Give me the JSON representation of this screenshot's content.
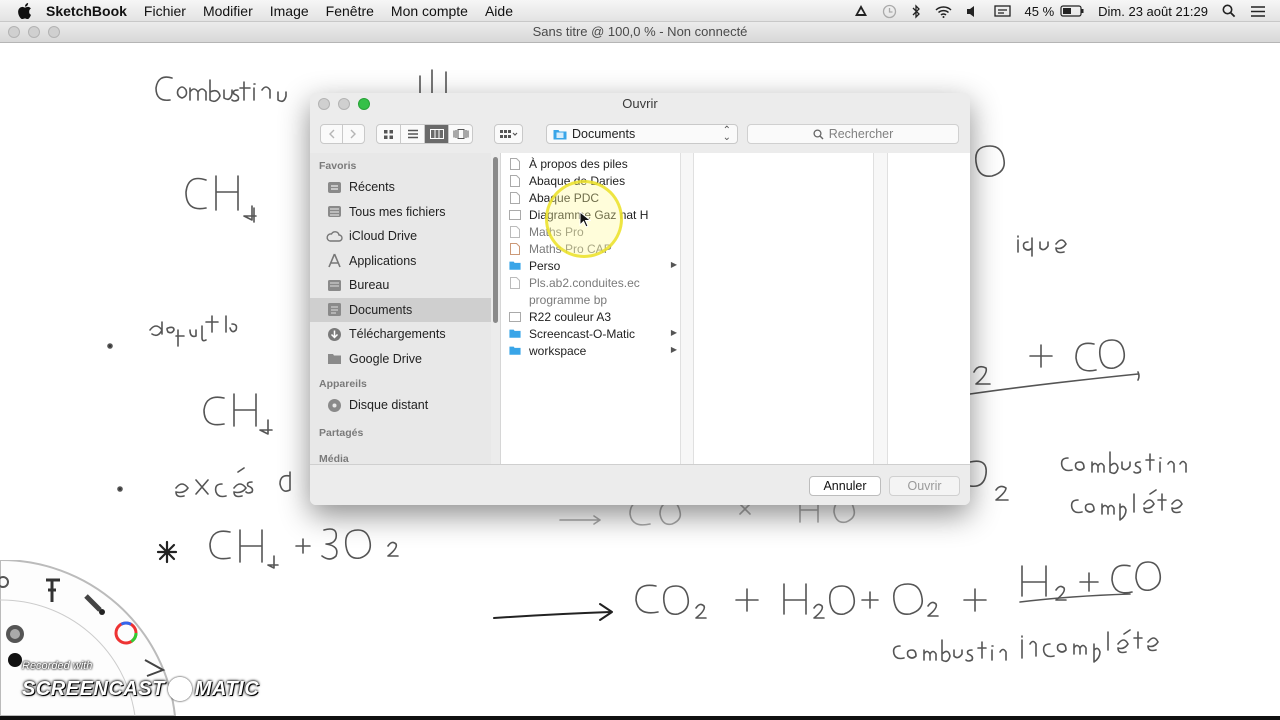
{
  "menubar": {
    "app_name": "SketchBook",
    "items": [
      "Fichier",
      "Modifier",
      "Image",
      "Fenêtre",
      "Mon compte",
      "Aide"
    ],
    "battery": "45 %",
    "datetime": "Dim. 23 août  21:29"
  },
  "window": {
    "title": "Sans titre @ 100,0 % - Non connecté"
  },
  "dialog": {
    "title": "Ouvrir",
    "location": "Documents",
    "search_placeholder": "Rechercher",
    "sidebar": {
      "sections": [
        {
          "heading": "Favoris",
          "items": [
            {
              "label": "Récents",
              "icon": "recents-icon"
            },
            {
              "label": "Tous mes fichiers",
              "icon": "all-files-icon"
            },
            {
              "label": "iCloud Drive",
              "icon": "cloud-icon"
            },
            {
              "label": "Applications",
              "icon": "applications-icon"
            },
            {
              "label": "Bureau",
              "icon": "desktop-icon"
            },
            {
              "label": "Documents",
              "icon": "documents-icon",
              "selected": true
            },
            {
              "label": "Téléchargements",
              "icon": "downloads-icon"
            },
            {
              "label": "Google Drive",
              "icon": "folder-icon"
            }
          ]
        },
        {
          "heading": "Appareils",
          "items": [
            {
              "label": "Disque distant",
              "icon": "disc-icon"
            }
          ]
        },
        {
          "heading": "Partagés",
          "items": []
        },
        {
          "heading": "Média",
          "items": []
        }
      ]
    },
    "files": [
      {
        "name": "À propos des piles",
        "type": "doc",
        "dim": false
      },
      {
        "name": "Abaque de Daries",
        "type": "doc",
        "dim": false
      },
      {
        "name": "Abaque PDC",
        "type": "doc",
        "dim": false
      },
      {
        "name": "Diagramme Gaz nat H",
        "type": "doc",
        "dim": false
      },
      {
        "name": "Maths Pro",
        "type": "doc",
        "dim": true
      },
      {
        "name": "Maths Pro CAP",
        "type": "doc",
        "dim": true
      },
      {
        "name": "Perso",
        "type": "folder",
        "dim": false
      },
      {
        "name": "Pls.ab2.conduites.ec",
        "type": "doc",
        "dim": true
      },
      {
        "name": "programme bp",
        "type": "doc",
        "dim": true
      },
      {
        "name": "R22 couleur A3",
        "type": "doc",
        "dim": false
      },
      {
        "name": "Screencast-O-Matic",
        "type": "folder",
        "dim": false
      },
      {
        "name": "workspace",
        "type": "folder",
        "dim": false
      }
    ],
    "buttons": {
      "cancel": "Annuler",
      "open": "Ouvrir"
    }
  },
  "watermark": {
    "recorded_with": "Recorded with",
    "brand_left": "SCREENCAST",
    "brand_right": "MATIC"
  },
  "colors": {
    "selection": "#cfcfcf",
    "folder_blue": "#39a5e8",
    "cursor_highlight": "#ebe128"
  }
}
